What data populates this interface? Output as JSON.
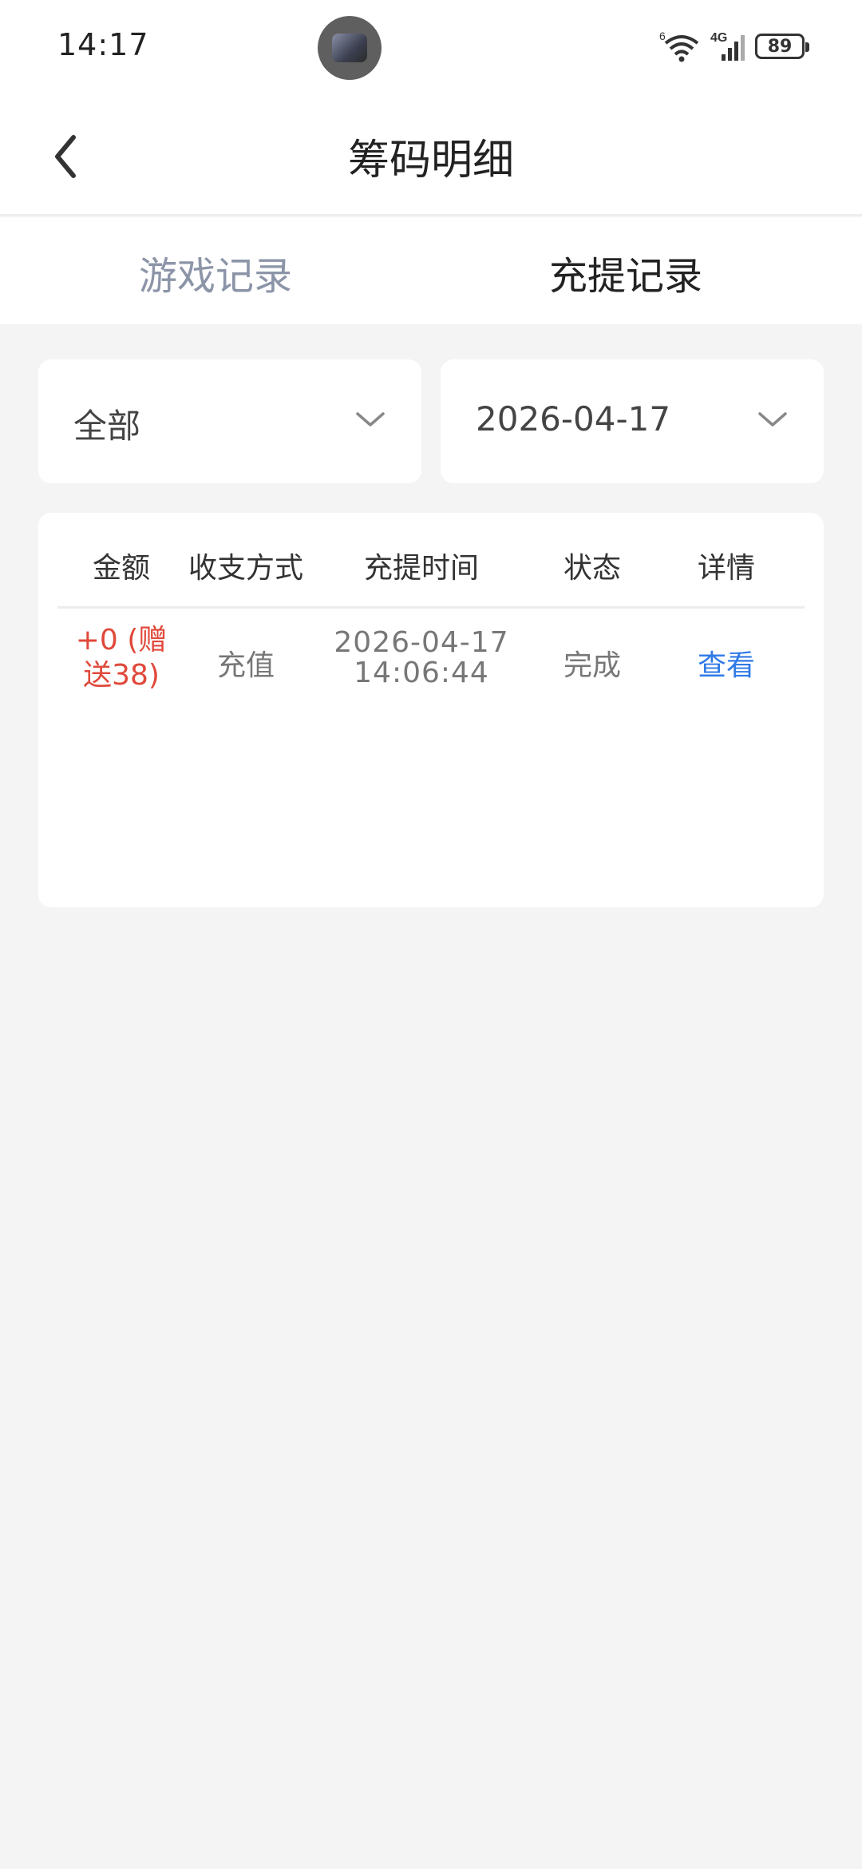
{
  "status_bar": {
    "time": "14:17",
    "network": "4G",
    "wifi_label": "6",
    "battery": "89",
    "icons": [
      "wifi-icon",
      "signal-icon",
      "battery-icon"
    ]
  },
  "header": {
    "title": "筹码明细",
    "back_icon": "chevron-left-icon"
  },
  "tabs": [
    {
      "label": "游戏记录",
      "active": false
    },
    {
      "label": "充提记录",
      "active": true
    }
  ],
  "filters": {
    "type": {
      "value": "全部",
      "icon": "chevron-down-icon"
    },
    "date": {
      "value": "2026-04-17",
      "icon": "chevron-down-icon"
    }
  },
  "table": {
    "columns": [
      "金额",
      "收支方式",
      "充提时间",
      "状态",
      "详情"
    ],
    "rows": [
      {
        "amount_line1": "+0 (赠",
        "amount_line2": "送38)",
        "method": "充值",
        "time_line1": "2026-04-17",
        "time_line2": "14:06:44",
        "status": "完成",
        "detail": "查看"
      }
    ]
  },
  "colors": {
    "accent_link": "#2f7ae5",
    "amount_red": "#e0483a",
    "tab_inactive": "#8c95a8",
    "background": "#f4f4f4"
  }
}
